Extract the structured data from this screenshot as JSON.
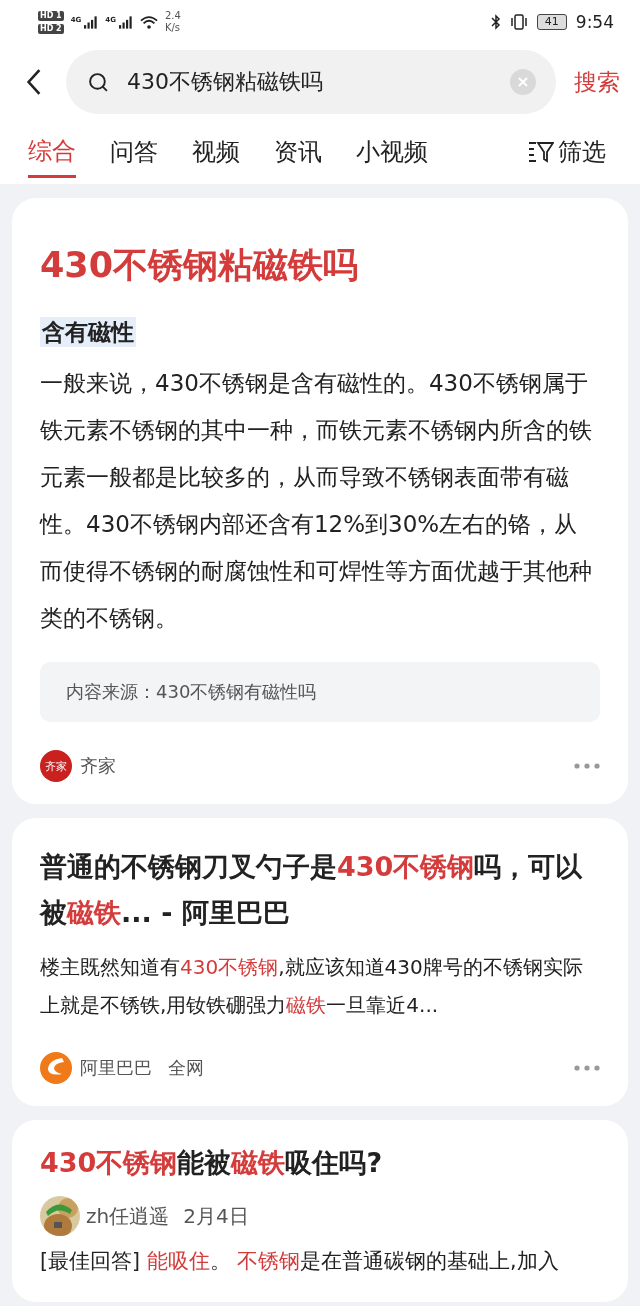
{
  "status_bar": {
    "sim_badges": [
      {
        "label": "HD",
        "slot": "1"
      },
      {
        "label": "HD",
        "slot": "2"
      }
    ],
    "networks": [
      "4G",
      "4G"
    ],
    "speed": [
      "2.4",
      "K/s"
    ],
    "battery": "41",
    "time": "9:54"
  },
  "search": {
    "value": "430不锈钢粘磁铁吗",
    "button": "搜索"
  },
  "tabs": [
    {
      "label": "综合",
      "selected": true
    },
    {
      "label": "问答",
      "selected": false
    },
    {
      "label": "视频",
      "selected": false
    },
    {
      "label": "资讯",
      "selected": false
    },
    {
      "label": "小视频",
      "selected": false
    }
  ],
  "filter": "筛选",
  "answer_card": {
    "title": "430不锈钢粘磁铁吗",
    "subtitle": "含有磁性",
    "body": "一般来说，430不锈钢是含有磁性的。430不锈钢属于铁元素不锈钢的其中一种，而铁元素不锈钢内所含的铁元素一般都是比较多的，从而导致不锈钢表面带有磁性。430不锈钢内部还含有12%到30%左右的铬，从而使得不锈钢的耐腐蚀性和可焊性等方面优越于其他种类的不锈钢。",
    "source": "内容来源：430不锈钢有磁性吗",
    "logo_text": "齐家",
    "site": "齐家"
  },
  "results": [
    {
      "kind": "article",
      "title": [
        {
          "text": "普通的不锈钢刀叉勺子是",
          "highlight": false
        },
        {
          "text": "430不锈钢",
          "highlight": true
        },
        {
          "text": "吗，可以被",
          "highlight": false
        },
        {
          "text": "磁铁",
          "highlight": true
        },
        {
          "text": "... - 阿里巴巴",
          "highlight": false
        }
      ],
      "snippet": [
        {
          "text": "楼主既然知道有",
          "highlight": false
        },
        {
          "text": "430不锈钢",
          "highlight": true
        },
        {
          "text": ",就应该知道430牌号的不锈钢实际上就是不锈铁,用钕铁硼强力",
          "highlight": false
        },
        {
          "text": "磁铁",
          "highlight": true
        },
        {
          "text": "一旦靠近4...",
          "highlight": false
        }
      ],
      "site": "阿里巴巴",
      "scope": "全网"
    },
    {
      "kind": "qa",
      "title": [
        {
          "text": "430不锈钢",
          "highlight": true
        },
        {
          "text": "能被",
          "highlight": false
        },
        {
          "text": "磁铁",
          "highlight": true
        },
        {
          "text": "吸住吗?",
          "highlight": false
        }
      ],
      "author": "zh任逍遥",
      "date": "2月4日",
      "snippet": [
        {
          "text": "[最佳回答] ",
          "highlight": false
        },
        {
          "text": "能吸住",
          "highlight": true
        },
        {
          "text": "。 ",
          "highlight": false
        },
        {
          "text": "不锈钢",
          "highlight": true
        },
        {
          "text": "是在普通碳钢的基础上,加入",
          "highlight": false
        }
      ]
    }
  ]
}
